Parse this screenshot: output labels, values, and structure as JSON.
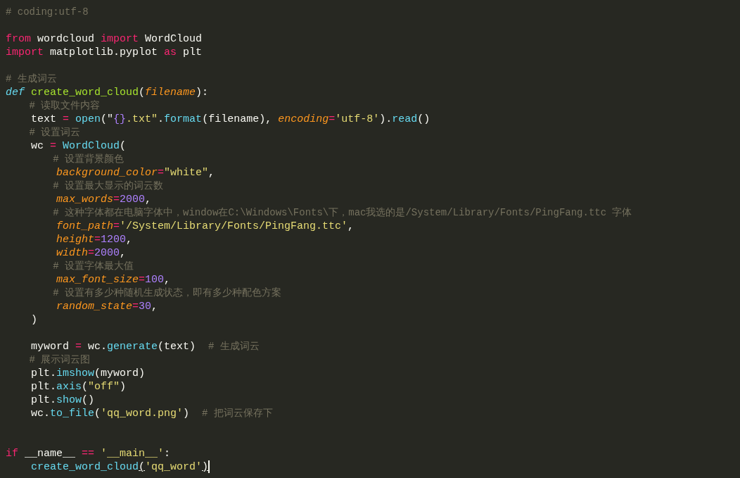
{
  "editor": {
    "lines": [
      {
        "kind": "code",
        "tokens": [
          {
            "text": "# coding:utf-8",
            "kind": "comment"
          }
        ]
      },
      {
        "kind": "blank"
      },
      {
        "kind": "code",
        "tokens": [
          {
            "text": "from",
            "kind": "keyword"
          },
          {
            "text": " wordcloud ",
            "kind": "plain"
          },
          {
            "text": "import",
            "kind": "keyword"
          },
          {
            "text": " WordCloud",
            "kind": "plain"
          }
        ]
      },
      {
        "kind": "code",
        "tokens": [
          {
            "text": "import",
            "kind": "keyword"
          },
          {
            "text": " matplotlib.pyplot ",
            "kind": "plain"
          },
          {
            "text": "as",
            "kind": "keyword"
          },
          {
            "text": " plt",
            "kind": "plain"
          }
        ]
      },
      {
        "kind": "blank"
      },
      {
        "kind": "code",
        "tokens": [
          {
            "text": "# 生成词云",
            "kind": "comment"
          }
        ]
      },
      {
        "kind": "code",
        "tokens": [
          {
            "text": "def",
            "kind": "storage"
          },
          {
            "text": " create_word_cloud",
            "kind": "function"
          },
          {
            "text": "(",
            "kind": "plain"
          },
          {
            "text": "filename",
            "kind": "param"
          },
          {
            "text": "):",
            "kind": "plain"
          }
        ]
      },
      {
        "kind": "code",
        "tokens": [
          {
            "text": "    # 读取文件内容",
            "kind": "comment"
          }
        ]
      },
      {
        "kind": "code",
        "tokens": [
          {
            "text": "    text ",
            "kind": "plain"
          },
          {
            "text": "=",
            "kind": "keyword"
          },
          {
            "text": " open",
            "kind": "call"
          },
          {
            "text": "(\"",
            "kind": "plain"
          },
          {
            "text": "{}",
            "kind": "number"
          },
          {
            "text": ".txt\"",
            "kind": "string"
          },
          {
            "text": ".",
            "kind": "plain"
          },
          {
            "text": "format",
            "kind": "call"
          },
          {
            "text": "(filename), ",
            "kind": "plain"
          },
          {
            "text": "encoding",
            "kind": "param"
          },
          {
            "text": "=",
            "kind": "keyword"
          },
          {
            "text": "'utf-8'",
            "kind": "string"
          },
          {
            "text": ").",
            "kind": "plain"
          },
          {
            "text": "read",
            "kind": "call"
          },
          {
            "text": "()",
            "kind": "plain"
          }
        ]
      },
      {
        "kind": "code",
        "tokens": [
          {
            "text": "    # 设置词云",
            "kind": "comment"
          }
        ]
      },
      {
        "kind": "code",
        "tokens": [
          {
            "text": "    wc ",
            "kind": "plain"
          },
          {
            "text": "=",
            "kind": "keyword"
          },
          {
            "text": " WordCloud",
            "kind": "call"
          },
          {
            "text": "(",
            "kind": "plain"
          }
        ]
      },
      {
        "kind": "code",
        "tokens": [
          {
            "text": "        # 设置背景颜色",
            "kind": "comment"
          }
        ]
      },
      {
        "kind": "code",
        "tokens": [
          {
            "text": "        background_color",
            "kind": "param"
          },
          {
            "text": "=",
            "kind": "keyword"
          },
          {
            "text": "\"white\"",
            "kind": "string"
          },
          {
            "text": ",",
            "kind": "plain"
          }
        ]
      },
      {
        "kind": "code",
        "tokens": [
          {
            "text": "        # 设置最大显示的词云数",
            "kind": "comment"
          }
        ]
      },
      {
        "kind": "code",
        "tokens": [
          {
            "text": "        max_words",
            "kind": "param"
          },
          {
            "text": "=",
            "kind": "keyword"
          },
          {
            "text": "2000",
            "kind": "number"
          },
          {
            "text": ",",
            "kind": "plain"
          }
        ]
      },
      {
        "kind": "code",
        "tokens": [
          {
            "text": "        # 这种字体都在电脑字体中，window在C:\\Windows\\Fonts\\下，mac我选的是/System/Library/Fonts/PingFang.ttc 字体",
            "kind": "comment"
          }
        ]
      },
      {
        "kind": "code",
        "tokens": [
          {
            "text": "        font_path",
            "kind": "param"
          },
          {
            "text": "=",
            "kind": "keyword"
          },
          {
            "text": "'/System/Library/Fonts/PingFang.ttc'",
            "kind": "string"
          },
          {
            "text": ",",
            "kind": "plain"
          }
        ]
      },
      {
        "kind": "code",
        "tokens": [
          {
            "text": "        height",
            "kind": "param"
          },
          {
            "text": "=",
            "kind": "keyword"
          },
          {
            "text": "1200",
            "kind": "number"
          },
          {
            "text": ",",
            "kind": "plain"
          }
        ]
      },
      {
        "kind": "code",
        "tokens": [
          {
            "text": "        width",
            "kind": "param"
          },
          {
            "text": "=",
            "kind": "keyword"
          },
          {
            "text": "2000",
            "kind": "number"
          },
          {
            "text": ",",
            "kind": "plain"
          }
        ]
      },
      {
        "kind": "code",
        "tokens": [
          {
            "text": "        # 设置字体最大值",
            "kind": "comment"
          }
        ]
      },
      {
        "kind": "code",
        "tokens": [
          {
            "text": "        max_font_size",
            "kind": "param"
          },
          {
            "text": "=",
            "kind": "keyword"
          },
          {
            "text": "100",
            "kind": "number"
          },
          {
            "text": ",",
            "kind": "plain"
          }
        ]
      },
      {
        "kind": "code",
        "tokens": [
          {
            "text": "        # 设置有多少种随机生成状态，即有多少种配色方案",
            "kind": "comment"
          }
        ]
      },
      {
        "kind": "code",
        "tokens": [
          {
            "text": "        random_state",
            "kind": "param"
          },
          {
            "text": "=",
            "kind": "keyword"
          },
          {
            "text": "30",
            "kind": "number"
          },
          {
            "text": ",",
            "kind": "plain"
          }
        ]
      },
      {
        "kind": "code",
        "tokens": [
          {
            "text": "    )",
            "kind": "plain"
          }
        ]
      },
      {
        "kind": "blank"
      },
      {
        "kind": "code",
        "tokens": [
          {
            "text": "    myword ",
            "kind": "plain"
          },
          {
            "text": "=",
            "kind": "keyword"
          },
          {
            "text": " wc.",
            "kind": "plain"
          },
          {
            "text": "generate",
            "kind": "call"
          },
          {
            "text": "(text)  ",
            "kind": "plain"
          },
          {
            "text": "# 生成词云",
            "kind": "comment"
          }
        ]
      },
      {
        "kind": "code",
        "tokens": [
          {
            "text": "    # 展示词云图",
            "kind": "comment"
          }
        ]
      },
      {
        "kind": "code",
        "tokens": [
          {
            "text": "    plt.",
            "kind": "plain"
          },
          {
            "text": "imshow",
            "kind": "call"
          },
          {
            "text": "(myword)",
            "kind": "plain"
          }
        ]
      },
      {
        "kind": "code",
        "tokens": [
          {
            "text": "    plt.",
            "kind": "plain"
          },
          {
            "text": "axis",
            "kind": "call"
          },
          {
            "text": "(",
            "kind": "plain"
          },
          {
            "text": "\"off\"",
            "kind": "string"
          },
          {
            "text": ")",
            "kind": "plain"
          }
        ]
      },
      {
        "kind": "code",
        "tokens": [
          {
            "text": "    plt.",
            "kind": "plain"
          },
          {
            "text": "show",
            "kind": "call"
          },
          {
            "text": "()",
            "kind": "plain"
          }
        ]
      },
      {
        "kind": "code",
        "tokens": [
          {
            "text": "    wc.",
            "kind": "plain"
          },
          {
            "text": "to_file",
            "kind": "call"
          },
          {
            "text": "(",
            "kind": "plain"
          },
          {
            "text": "'qq_word.png'",
            "kind": "string"
          },
          {
            "text": ")  ",
            "kind": "plain"
          },
          {
            "text": "# 把词云保存下",
            "kind": "comment"
          }
        ]
      },
      {
        "kind": "blank"
      },
      {
        "kind": "blank"
      },
      {
        "kind": "code",
        "tokens": [
          {
            "text": "if",
            "kind": "keyword"
          },
          {
            "text": " __name__ ",
            "kind": "plain"
          },
          {
            "text": "==",
            "kind": "keyword"
          },
          {
            "text": " '__main__'",
            "kind": "string"
          },
          {
            "text": ":",
            "kind": "plain"
          }
        ]
      },
      {
        "kind": "code",
        "cursor": true,
        "tokens": [
          {
            "text": "    create_word_cloud",
            "kind": "call"
          },
          {
            "text": "(",
            "kind": "bracket-match"
          },
          {
            "text": "'qq_word'",
            "kind": "string"
          },
          {
            "text": ")",
            "kind": "bracket-match"
          }
        ]
      }
    ]
  }
}
